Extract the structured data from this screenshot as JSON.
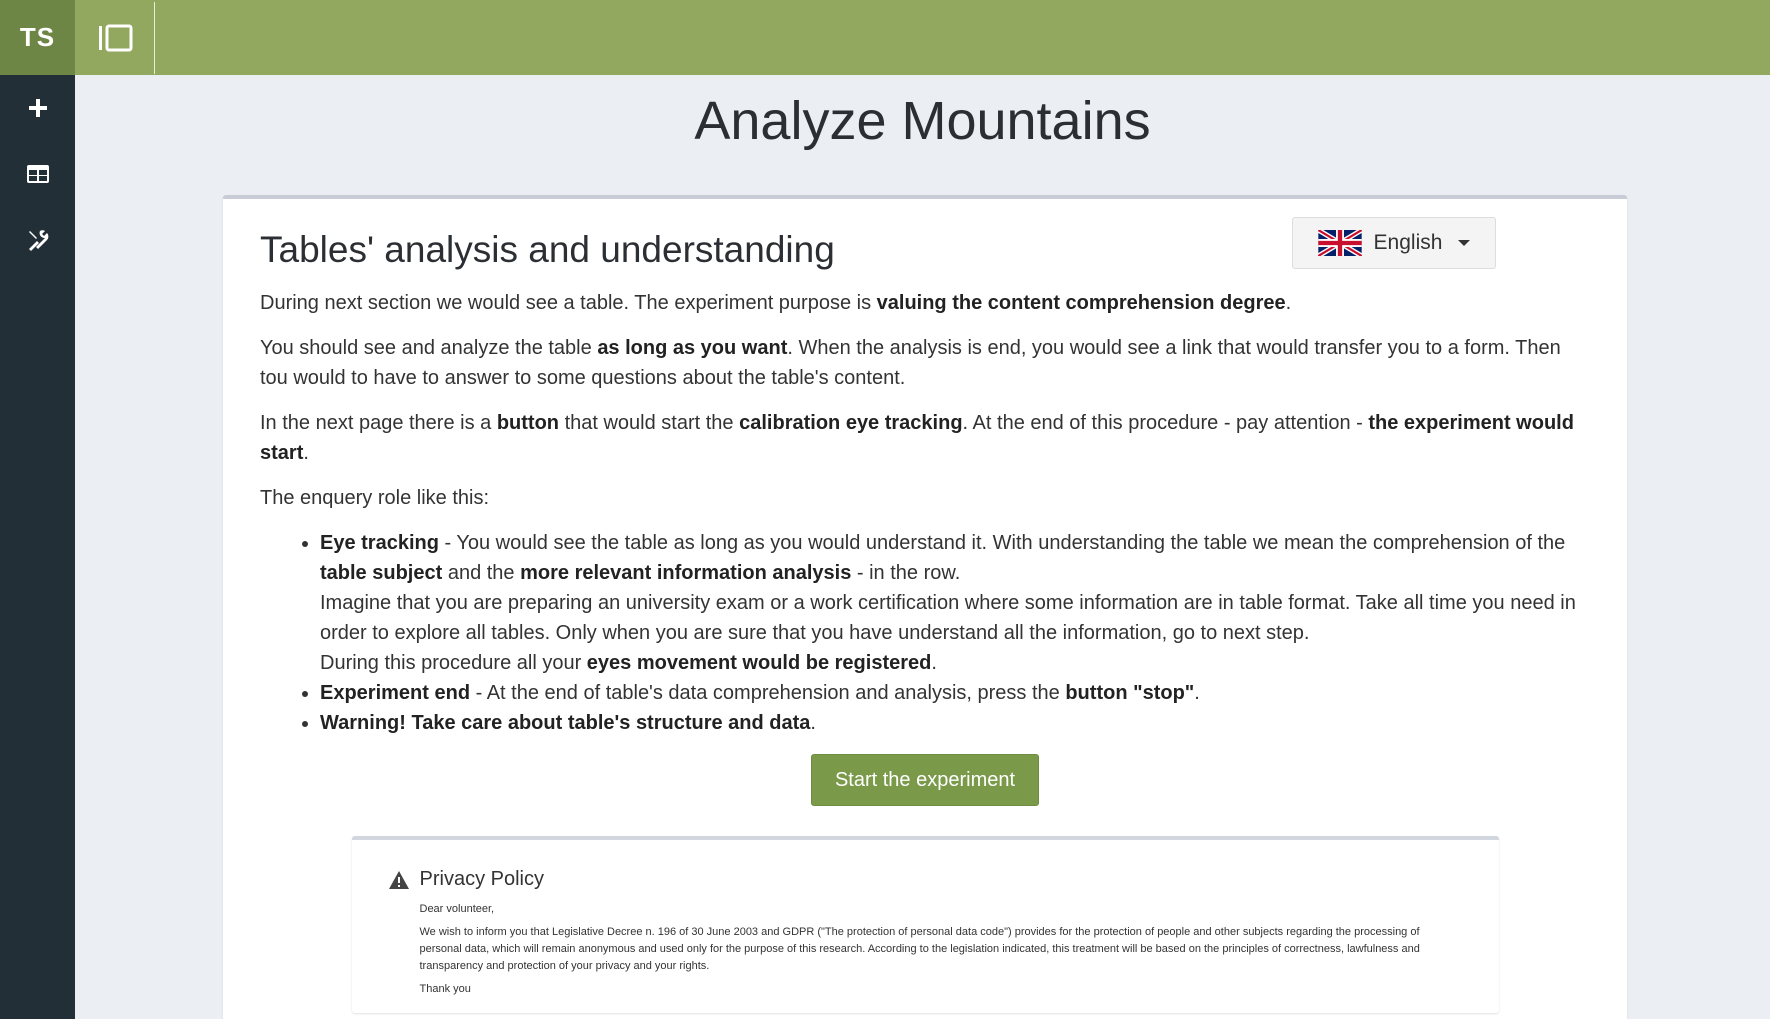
{
  "brand": {
    "label": "TS"
  },
  "sidebar": {
    "items": [
      {
        "icon": "plus-icon"
      },
      {
        "icon": "table-icon"
      },
      {
        "icon": "tools-icon"
      }
    ]
  },
  "topbar": {
    "toggle_icon": "sidebar-toggle-icon"
  },
  "page": {
    "title": "Analyze Mountains"
  },
  "section": {
    "title": "Tables' analysis and understanding",
    "language": {
      "label": "English",
      "flag": "uk-flag-icon"
    },
    "p1": {
      "t1": "During next section we would see a table. The experiment purpose is ",
      "b1": "valuing the content comprehension degree",
      "t2": "."
    },
    "p2": {
      "t1": "You should see and analyze the table ",
      "b1": "as long as you want",
      "t2": ". When the analysis is end, you would see a link that would transfer you to a form. Then tou would to have to answer to some questions about the table's content."
    },
    "p3": {
      "t1": "In the next page there is a ",
      "b1": "button",
      "t2": " that would start the ",
      "b2": "calibration eye tracking",
      "t3": ". At the end of this procedure - pay attention - ",
      "b3": "the experiment would start",
      "t4": "."
    },
    "p4": "The enquery role like this:",
    "bullets": {
      "eye": {
        "b1": "Eye tracking",
        "t1": " - You would see the table as long as you would understand it. With understanding the table we mean the comprehension of the ",
        "b2": "table subject",
        "t2": " and the ",
        "b3": "more relevant information analysis",
        "t3": " - in the row.",
        "line2": "Imagine that you are preparing an university exam or a work certification where some information are in table format. Take all time you need in order to explore all tables. Only when you are sure that you have understand all the information, go to next step.",
        "t4": "During this procedure all your ",
        "b4": "eyes movement would be registered",
        "t5": "."
      },
      "end": {
        "b1": "Experiment end",
        "t1": " - At the end of table's data comprehension and analysis, press the ",
        "b2": "button \"stop\"",
        "t2": "."
      },
      "warn": {
        "b1": "Warning! Take care about table's structure and data",
        "t1": "."
      }
    },
    "start_label": "Start the experiment"
  },
  "privacy": {
    "title": "Privacy Policy",
    "greeting": "Dear volunteer,",
    "body": "We wish to inform you that Legislative Decree n. 196 of 30 June 2003 and GDPR (\"The protection of personal data code\") provides for the protection of people and other subjects regarding the processing of personal data, which will remain anonymous and used only for the purpose of this research. According to the legislation indicated, this treatment will be based on the principles of correctness, lawfulness and transparency and protection of your privacy and your rights.",
    "closing": "Thank you"
  },
  "colors": {
    "topbar": "#92a85e",
    "brand": "#6e8645",
    "sidebar": "#232f36",
    "button": "#7a9a4a"
  }
}
